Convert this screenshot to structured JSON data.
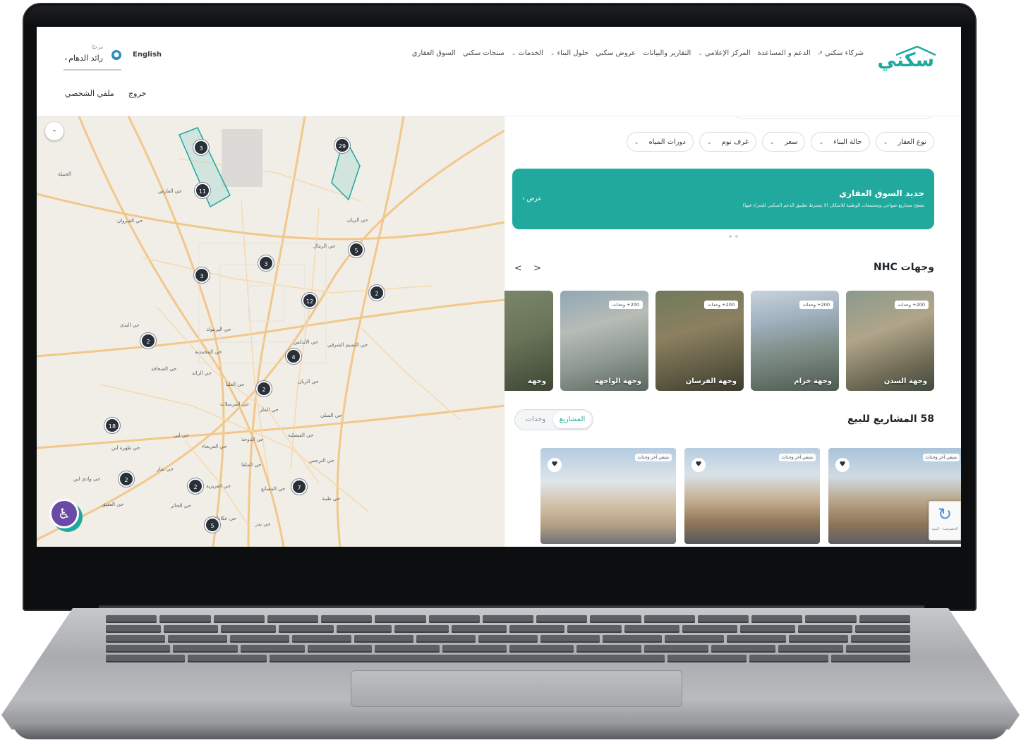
{
  "header": {
    "logo_text": "سكني",
    "nav": [
      {
        "label": "السوق العقاري",
        "dropdown": false
      },
      {
        "label": "منتجات سكني",
        "dropdown": false
      },
      {
        "label": "الخدمات",
        "dropdown": true
      },
      {
        "label": "حلول البناء",
        "dropdown": true
      },
      {
        "label": "عروض سكني",
        "dropdown": false
      },
      {
        "label": "التقارير والبيانات",
        "dropdown": false
      },
      {
        "label": "المركز الإعلامي",
        "dropdown": true
      },
      {
        "label": "الدعم و المساعدة",
        "dropdown": false
      },
      {
        "label": "شركاء سكني",
        "dropdown": false,
        "external": true
      }
    ],
    "language": "English",
    "user_greeting": "مرحبًا",
    "user_name": "رائد الدهام",
    "logout": "خروج",
    "profile": "ملفي الشخصي"
  },
  "map": {
    "labels": [
      {
        "text": "حي العارض"
      },
      {
        "text": "حي القيروان"
      },
      {
        "text": "حي النرجس"
      },
      {
        "text": "حي الرمال"
      },
      {
        "text": "حي اليرموك"
      },
      {
        "text": "حي العقيق"
      },
      {
        "text": "حي الملقا"
      },
      {
        "text": "حي الصحافة"
      },
      {
        "text": "حي الندى"
      },
      {
        "text": "حي المحمدية"
      },
      {
        "text": "حي الرائد"
      },
      {
        "text": "حي الأندلس"
      },
      {
        "text": "حي النسيم الشرقي"
      },
      {
        "text": "حي الريان"
      },
      {
        "text": "حي الملز"
      },
      {
        "text": "حي العليا"
      },
      {
        "text": "حي المرسلات"
      },
      {
        "text": "حي الدوحة"
      },
      {
        "text": "حي الفيصلية"
      },
      {
        "text": "حي السلي"
      },
      {
        "text": "حي العريجاء"
      },
      {
        "text": "حي لبن"
      },
      {
        "text": "حي ظهرة لبن"
      },
      {
        "text": "حي نمار"
      },
      {
        "text": "حي وادي لبن"
      },
      {
        "text": "حي العزيزية"
      },
      {
        "text": "حي بدر"
      },
      {
        "text": "حي الحائر"
      },
      {
        "text": "حي عكاظ"
      },
      {
        "text": "حي المصانع"
      },
      {
        "text": "حي طيبة"
      },
      {
        "text": "حي الجنادرية"
      },
      {
        "text": "الجبيلة"
      }
    ],
    "clusters": [
      "3",
      "11",
      "29",
      "5",
      "3",
      "3",
      "12",
      "2",
      "2",
      "4",
      "2",
      "18",
      "2",
      "2",
      "7",
      "5"
    ],
    "zoom_label": "-"
  },
  "filters": [
    {
      "label": "نوع العقار"
    },
    {
      "label": "حالة البناء"
    },
    {
      "label": "سعر"
    },
    {
      "label": "غرف نوم"
    },
    {
      "label": "دورات المياه"
    }
  ],
  "banner": {
    "title": "جديد السوق العقاري",
    "subtitle": "تصفح مشاريع ضواحي ومجتمعات الوطنية للاسكان (لا يشترط تطبيق الدعم السكني للشراء فيها)",
    "cta": "عرض"
  },
  "destinations": {
    "title": "وجهات NHC",
    "arrows": "< >",
    "items": [
      {
        "badge": "200+ وحدات",
        "name": "وجهة السدن"
      },
      {
        "badge": "200+ وحدات",
        "name": "وجهة خزام"
      },
      {
        "badge": "200+ وحدات",
        "name": "وجهة الفرسان"
      },
      {
        "badge": "200+ وحدات",
        "name": "وجهة الواجهة"
      },
      {
        "badge": "",
        "name": "وجهة"
      }
    ]
  },
  "projects": {
    "count": "58",
    "title": "58 المشاريع للبيع",
    "toggle": {
      "active": "المشاريع",
      "inactive": "وحدات"
    },
    "items": [
      {
        "badge": "متبقي آخر وحدات"
      },
      {
        "badge": "متبقي آخر وحدات"
      },
      {
        "badge": "متبقي آخر وحدات"
      }
    ]
  },
  "recaptcha": {
    "text": "الخصوصية - البنود"
  },
  "colors": {
    "brand": "#1fa99e",
    "accessibility": "#6a4aa5",
    "cluster": "#2a3038"
  },
  "icons": {
    "user": "user-icon",
    "external": "external-link-icon",
    "accessibility": "accessibility-icon",
    "favorite": "heart-icon"
  }
}
